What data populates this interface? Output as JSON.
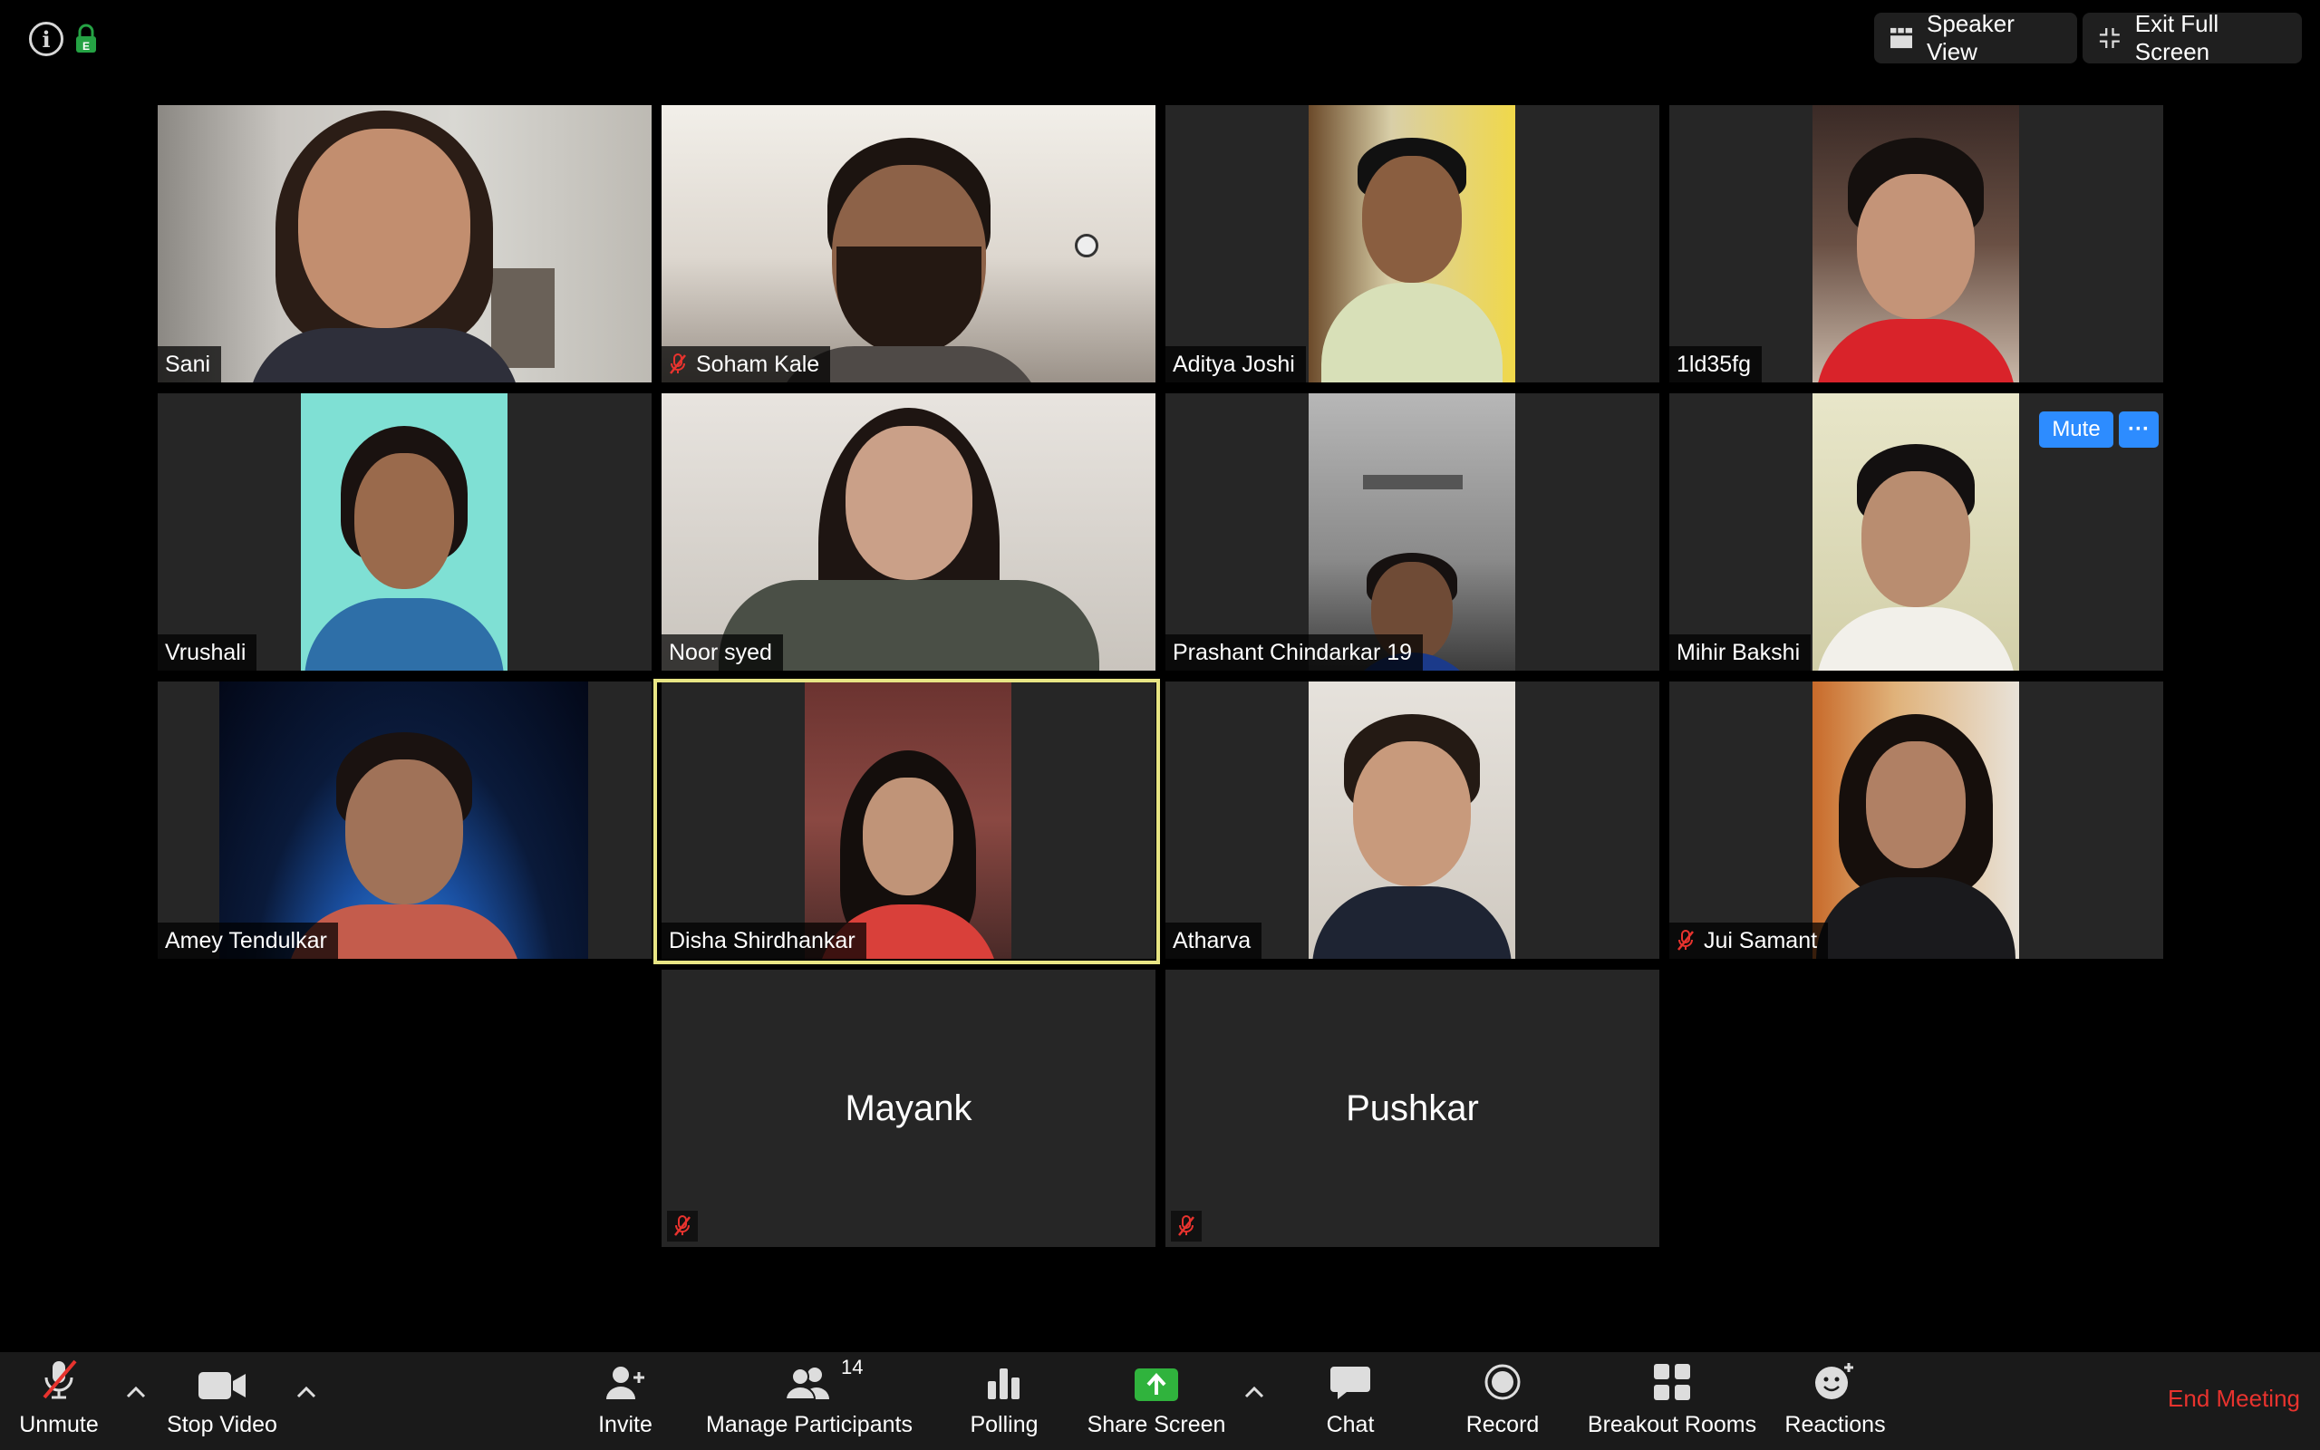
{
  "top_bar": {
    "speaker_view_label": "Speaker View",
    "exit_full_screen_label": "Exit Full Screen"
  },
  "participants": [
    {
      "name": "Sani",
      "muted": false,
      "video": true
    },
    {
      "name": "Soham Kale",
      "muted": true,
      "video": true
    },
    {
      "name": "Aditya Joshi",
      "muted": false,
      "video": true
    },
    {
      "name": "1ld35fg",
      "muted": false,
      "video": true
    },
    {
      "name": "Vrushali",
      "muted": false,
      "video": true
    },
    {
      "name": "Noor syed",
      "muted": false,
      "video": true
    },
    {
      "name": "Prashant Chindarkar 19",
      "muted": false,
      "video": true
    },
    {
      "name": "Mihir Bakshi",
      "muted": false,
      "video": true
    },
    {
      "name": "Amey Tendulkar",
      "muted": false,
      "video": true
    },
    {
      "name": "Disha Shirdhankar",
      "muted": false,
      "video": true,
      "active_speaker": true
    },
    {
      "name": "Atharva",
      "muted": false,
      "video": true
    },
    {
      "name": "Jui Samant",
      "muted": true,
      "video": true
    },
    {
      "name": "Mayank",
      "muted": true,
      "video": false
    },
    {
      "name": "Pushkar",
      "muted": true,
      "video": false
    }
  ],
  "tile_actions": {
    "mute_label": "Mute",
    "more_label": "···"
  },
  "toolbar": {
    "unmute_label": "Unmute",
    "stop_video_label": "Stop Video",
    "invite_label": "Invite",
    "manage_participants_label": "Manage Participants",
    "participant_count": "14",
    "polling_label": "Polling",
    "share_screen_label": "Share Screen",
    "chat_label": "Chat",
    "record_label": "Record",
    "breakout_rooms_label": "Breakout Rooms",
    "reactions_label": "Reactions",
    "end_meeting_label": "End Meeting"
  },
  "colors": {
    "background": "#000000",
    "tile": "#262626",
    "toolbar": "#1a1a1a",
    "accent_blue": "#2d8cff",
    "end_red": "#e8332e",
    "active_speaker_border": "#e8e584",
    "share_green": "#30b33d"
  }
}
